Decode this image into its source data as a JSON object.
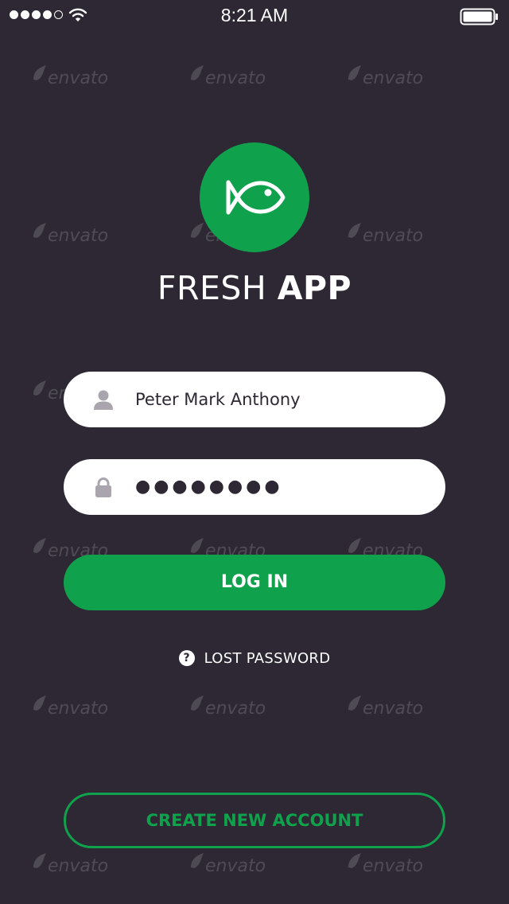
{
  "status_bar": {
    "time": "8:21 AM",
    "signal_strength": "4 of 5",
    "icons": [
      "signal-dots-icon",
      "wifi-icon",
      "battery-icon"
    ]
  },
  "watermark": {
    "text": "envato"
  },
  "logo": {
    "icon": "fish-icon",
    "color": "#0fa14c"
  },
  "app_title": {
    "light": "FRESH",
    "bold": "APP"
  },
  "login_form": {
    "username": {
      "icon": "user-icon",
      "value": "Peter Mark Anthony"
    },
    "password": {
      "icon": "lock-icon",
      "value": "●●●●●●●●"
    },
    "login_label": "LOG IN",
    "lost_password": {
      "icon": "question-icon",
      "icon_glyph": "?",
      "label": "LOST PASSWORD"
    },
    "create_account_label": "CREATE NEW ACCOUNT"
  },
  "colors": {
    "background": "#2d2834",
    "accent": "#0fa14c",
    "field_background": "#ffffff"
  }
}
